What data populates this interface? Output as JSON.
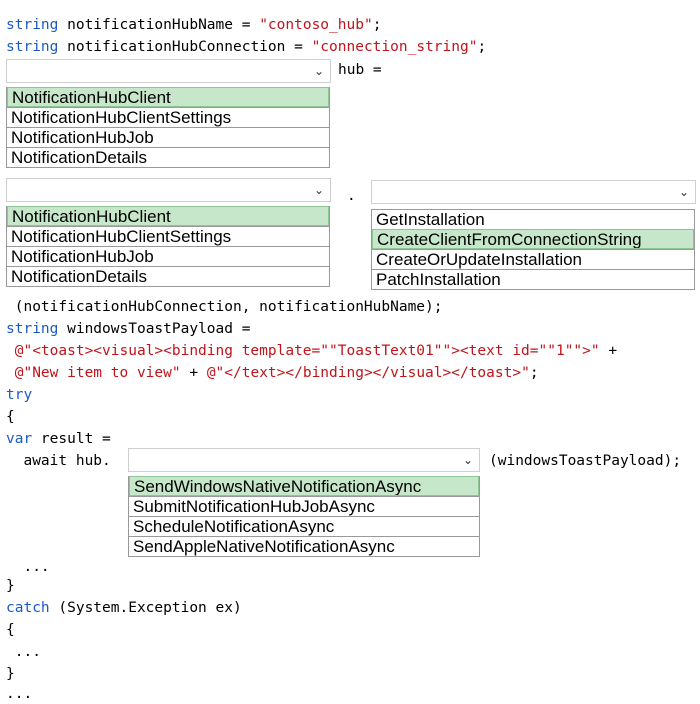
{
  "code": {
    "l1_type": "string",
    "l1_decl": " notificationHubName = ",
    "l1_val": "\"contoso_hub\"",
    "l1_end": ";",
    "l2_type": "string",
    "l2_decl": " notificationHubConnection = ",
    "l2_val": "\"connection_string\"",
    "l2_end": ";",
    "hub_assign": "hub =",
    "dot": ".",
    "args_line": " (notificationHubConnection, notificationHubName);",
    "l_payload_type": "string",
    "l_payload_decl": " windowsToastPayload =",
    "payload1_str": " @\"<toast><visual><binding template=\"\"ToastText01\"\"><text id=\"\"1\"\">\"",
    "payload1_end": " +",
    "payload2_str_a": " @\"New item to view\"",
    "payload2_mid": " + ",
    "payload2_str_b": "@\"</text></binding></visual></toast>\"",
    "payload2_end": ";",
    "try_kw": "try",
    "open_brace_1": "{",
    "var_kw": "var",
    "var_rest": " result =",
    "await_line": "  await hub.",
    "send_args": "(windowsToastPayload);",
    "ellipsis_1": "  ...",
    "close_brace_1": "}",
    "catch_kw": "catch",
    "catch_rest": " (System.Exception ex)",
    "open_brace_2": "{",
    "ellipsis_2": " ...",
    "close_brace_2": "}",
    "ellipsis_3": "..."
  },
  "dropdown1": {
    "selected": "",
    "options": [
      "NotificationHubClient",
      "NotificationHubClientSettings",
      "NotificationHubJob",
      "NotificationDetails"
    ],
    "highlighted": "NotificationHubClient"
  },
  "dropdown2": {
    "selected": "",
    "options": [
      "NotificationHubClient",
      "NotificationHubClientSettings",
      "NotificationHubJob",
      "NotificationDetails"
    ],
    "highlighted": "NotificationHubClient"
  },
  "dropdown3": {
    "selected": "",
    "options": [
      "GetInstallation",
      "CreateClientFromConnectionString",
      "CreateOrUpdateInstallation",
      "PatchInstallation"
    ],
    "highlighted": "CreateClientFromConnectionString"
  },
  "dropdown4": {
    "selected": "",
    "options": [
      "SendWindowsNativeNotificationAsync",
      "SubmitNotificationHubJobAsync",
      "ScheduleNotificationAsync",
      "SendAppleNativeNotificationAsync"
    ],
    "highlighted": "SendWindowsNativeNotificationAsync"
  },
  "icons": {
    "dropdown_chevron": "chevron-down-icon"
  },
  "colors": {
    "keyword": "#1b5ac4",
    "string": "#c0141b",
    "highlight": "#c6e7c9"
  }
}
